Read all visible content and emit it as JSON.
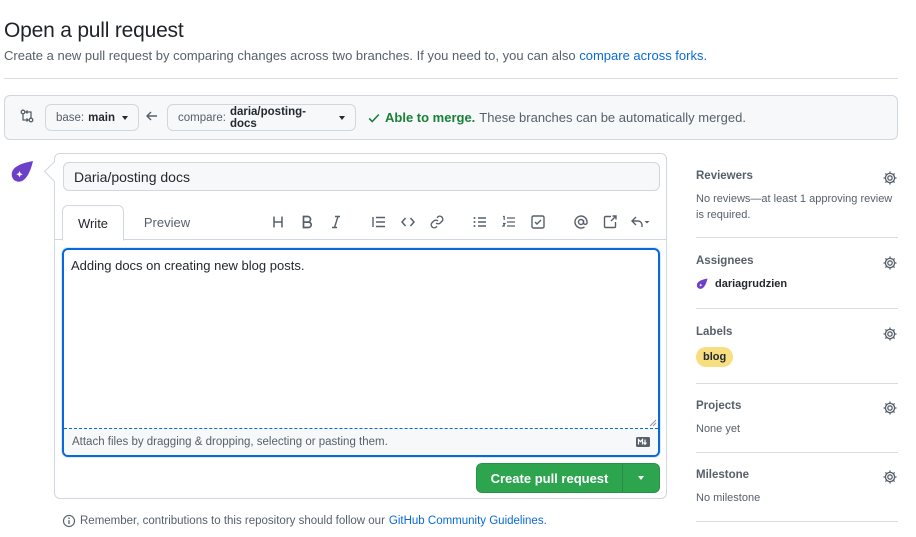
{
  "page": {
    "title": "Open a pull request",
    "subtitle_prefix": "Create a new pull request by comparing changes across two branches. If you need to, you can also ",
    "subtitle_link": "compare across forks."
  },
  "compare": {
    "base_label": "base:",
    "base_value": "main",
    "compare_label": "compare:",
    "compare_value": "daria/posting-docs",
    "status_ok": "Able to merge.",
    "status_text": "These branches can be automatically merged."
  },
  "form": {
    "title_value": "Daria/posting docs",
    "tabs": [
      "Write",
      "Preview"
    ],
    "body_text": "Adding docs on creating new blog posts.",
    "attach_text": "Attach files by dragging & dropping, selecting or pasting them.",
    "submit_label": "Create pull request"
  },
  "toolbar": {
    "icons": [
      "heading-icon",
      "bold-icon",
      "italic-icon",
      "quote-icon",
      "code-icon",
      "link-icon",
      "unordered-list-icon",
      "ordered-list-icon",
      "task-list-icon",
      "mention-icon",
      "cross-reference-icon",
      "saved-replies-icon"
    ]
  },
  "notice": {
    "prefix": "Remember, contributions to this repository should follow our ",
    "link": "GitHub Community Guidelines."
  },
  "sidebar": {
    "reviewers": {
      "title": "Reviewers",
      "body": "No reviews—at least 1 approving review is required."
    },
    "assignees": {
      "title": "Assignees",
      "user": "dariagrudzien"
    },
    "labels": {
      "title": "Labels",
      "label": "blog",
      "label_color": "#f7de80"
    },
    "projects": {
      "title": "Projects",
      "body": "None yet"
    },
    "milestone": {
      "title": "Milestone",
      "body": "No milestone"
    }
  },
  "colors": {
    "accent": "#0969da",
    "success": "#1a7f37",
    "button_green": "#2da44e",
    "avatar": "#6e40c9"
  }
}
